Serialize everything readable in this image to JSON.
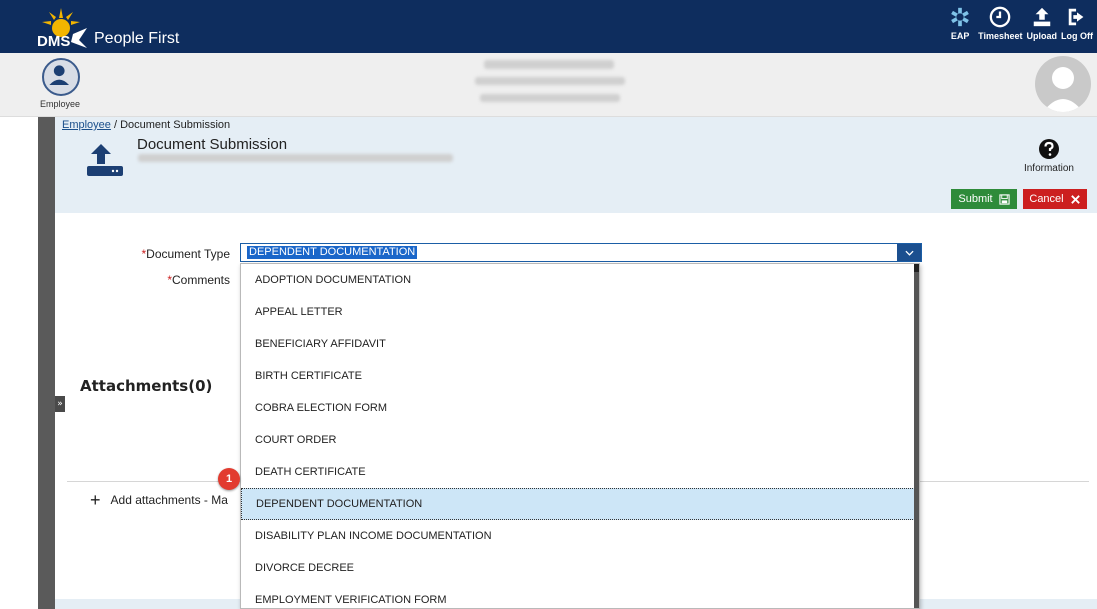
{
  "header": {
    "logo_text": "DMS",
    "app_title": "People First",
    "actions": [
      {
        "label": "EAP",
        "icon": "eap-icon"
      },
      {
        "label": "Timesheet",
        "icon": "clock-icon"
      },
      {
        "label": "Upload",
        "icon": "upload-icon"
      },
      {
        "label": "Log Off",
        "icon": "logout-icon"
      }
    ]
  },
  "userbar": {
    "employee_label": "Employee"
  },
  "breadcrumb": {
    "parent": "Employee",
    "separator": " / ",
    "current": "Document Submission"
  },
  "page": {
    "title": "Document Submission",
    "info_label": "Information",
    "submit_label": "Submit",
    "cancel_label": "Cancel"
  },
  "form": {
    "document_type_label": "Document Type",
    "comments_label": "Comments",
    "required_marker": "*",
    "document_type_value": "DEPENDENT DOCUMENTATION"
  },
  "attachments": {
    "title": "Attachments(0)",
    "add_label": "Add attachments - Ma"
  },
  "dropdown": {
    "options": [
      "ADOPTION DOCUMENTATION",
      "APPEAL LETTER",
      "BENEFICIARY AFFIDAVIT",
      "BIRTH CERTIFICATE",
      "COBRA ELECTION FORM",
      "COURT ORDER",
      "DEATH CERTIFICATE",
      "DEPENDENT DOCUMENTATION",
      "DISABILITY PLAN INCOME DOCUMENTATION",
      "DIVORCE DECREE",
      "EMPLOYMENT VERIFICATION FORM"
    ],
    "selected_index": 7
  },
  "callout": {
    "number": "1"
  },
  "colors": {
    "topbar": "#0e2d5e",
    "submit": "#2e8b3a",
    "cancel": "#cc1f1f",
    "selected_option": "#cde6f7",
    "callout": "#e23b2f"
  }
}
